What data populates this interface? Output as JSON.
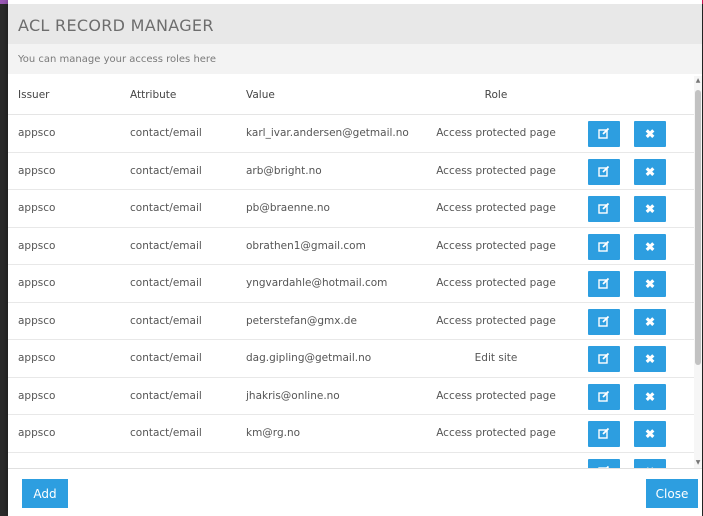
{
  "top_colors": [
    "#9b59b6",
    "#3a3a3a",
    "#e67e22",
    "#2ecc71",
    "#3a3a3a",
    "#3498db",
    "#3a3a3a",
    "#c0392b",
    "#3a3a3a",
    "#e91e63"
  ],
  "accent": "#2d9ee0",
  "modal": {
    "title": "ACL RECORD MANAGER",
    "subtitle": "You can manage your access roles here"
  },
  "table": {
    "columns": [
      "Issuer",
      "Attribute",
      "Value",
      "Role"
    ],
    "rows": [
      {
        "issuer": "appsco",
        "attribute": "contact/email",
        "value": "karl_ivar.andersen@getmail.no",
        "role": "Access protected page"
      },
      {
        "issuer": "appsco",
        "attribute": "contact/email",
        "value": "arb@bright.no",
        "role": "Access protected page"
      },
      {
        "issuer": "appsco",
        "attribute": "contact/email",
        "value": "pb@braenne.no",
        "role": "Access protected page"
      },
      {
        "issuer": "appsco",
        "attribute": "contact/email",
        "value": "obrathen1@gmail.com",
        "role": "Access protected page"
      },
      {
        "issuer": "appsco",
        "attribute": "contact/email",
        "value": "yngvardahle@hotmail.com",
        "role": "Access protected page"
      },
      {
        "issuer": "appsco",
        "attribute": "contact/email",
        "value": "peterstefan@gmx.de",
        "role": "Access protected page"
      },
      {
        "issuer": "appsco",
        "attribute": "contact/email",
        "value": "dag.gipling@getmail.no",
        "role": "Edit site"
      },
      {
        "issuer": "appsco",
        "attribute": "contact/email",
        "value": "jhakris@online.no",
        "role": "Access protected page"
      },
      {
        "issuer": "appsco",
        "attribute": "contact/email",
        "value": "km@rg.no",
        "role": "Access protected page"
      },
      {
        "issuer": "",
        "attribute": "",
        "value": "",
        "role": ""
      }
    ],
    "edit_icon": "edit-icon",
    "delete_icon": "delete-icon"
  },
  "footer": {
    "add_label": "Add",
    "close_label": "Close"
  }
}
